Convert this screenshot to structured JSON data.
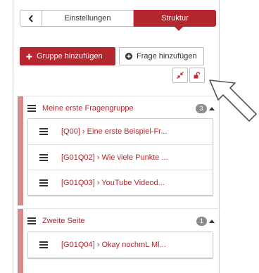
{
  "tabs": {
    "settings_label": "Einstellungen",
    "structure_label": "Struktur"
  },
  "actions": {
    "add_group_label": "Gruppe hinzufügen",
    "add_question_label": "Frage hinzufügen"
  },
  "groups": [
    {
      "title": "Meine erste Fragengruppe",
      "count": "3",
      "questions": [
        "[Q00] › Eine erste Beispiel-Fr...",
        "[G01Q02] › Wie viele Punkte ...",
        "[G01Q03] › YouTube Videod..."
      ]
    },
    {
      "title": "Zweite Seite",
      "count": "1",
      "questions": [
        "[G01Q04] › Okay nochmL Ml..."
      ]
    }
  ],
  "colors": {
    "accent": "#b5272f",
    "group_bar": "#d68a8e"
  }
}
